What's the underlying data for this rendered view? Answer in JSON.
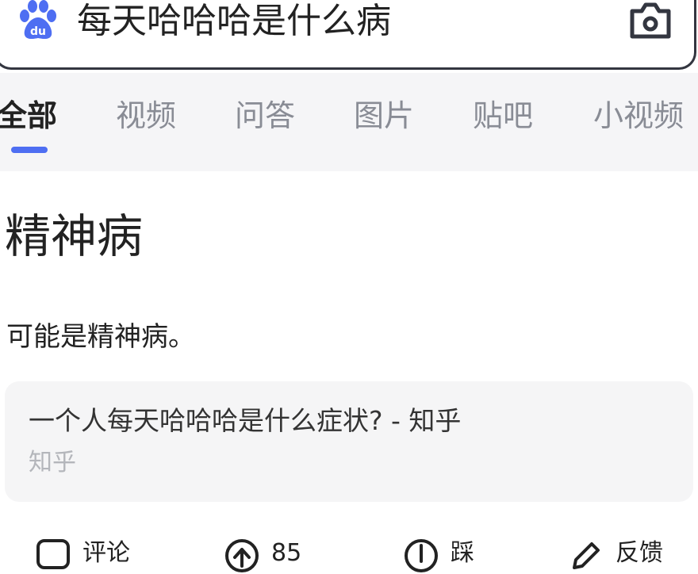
{
  "search": {
    "query": "每天哈哈哈是什么病",
    "logo_text": "du"
  },
  "tabs": [
    {
      "label": "全部",
      "active": true
    },
    {
      "label": "视频",
      "active": false
    },
    {
      "label": "问答",
      "active": false
    },
    {
      "label": "图片",
      "active": false
    },
    {
      "label": "贴吧",
      "active": false
    },
    {
      "label": "小视频",
      "active": false
    }
  ],
  "result": {
    "title": "精神病",
    "description": "可能是精神病。",
    "source": {
      "title": "一个人每天哈哈哈是什么症状? - 知乎",
      "site": "知乎"
    }
  },
  "actions": {
    "comment_label": "评论",
    "upvote_count": "85",
    "downvote_label": "踩",
    "feedback_label": "反馈"
  },
  "colors": {
    "accent": "#4e6ef2",
    "tab_inactive": "#898c95",
    "card_bg": "#f5f5f6",
    "muted_text": "#b4b6bb"
  }
}
